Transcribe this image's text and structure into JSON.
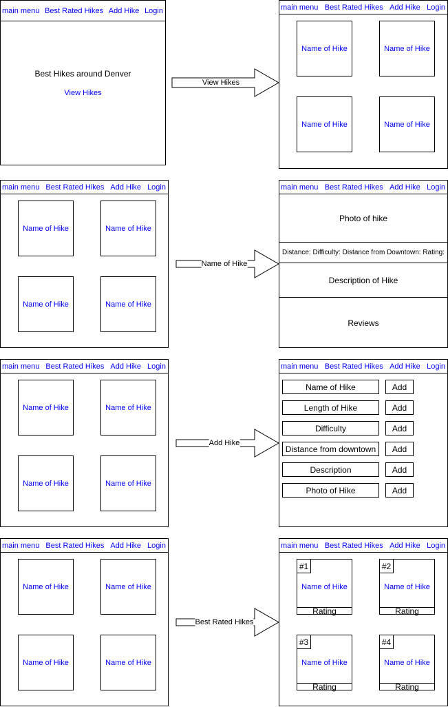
{
  "nav": [
    "main menu",
    "Best Rated Hikes",
    "Add Hike",
    "Login"
  ],
  "home": {
    "title": "Best Hikes around Denver",
    "link": "View Hikes"
  },
  "card_label": "Name of Hike",
  "arrows": [
    "View Hikes",
    "Name of Hike",
    "Add Hike",
    "Best Rated Hikes"
  ],
  "detail": {
    "photo": "Photo of hike",
    "info": "Distance: Difficulty: Distance from Downtown: Rating:",
    "description": "Description of Hike",
    "reviews": "Reviews"
  },
  "add_form": {
    "fields": [
      "Name of Hike",
      "Length of Hike",
      "Difficulty",
      "Distance from downtown",
      "Description",
      "Photo of Hike"
    ],
    "button": "Add"
  },
  "best_rated": {
    "ranks": [
      "#1",
      "#2",
      "#3",
      "#4"
    ],
    "rating_label": "Rating"
  },
  "colors": {
    "link": "#0000ff",
    "line": "#000000"
  }
}
